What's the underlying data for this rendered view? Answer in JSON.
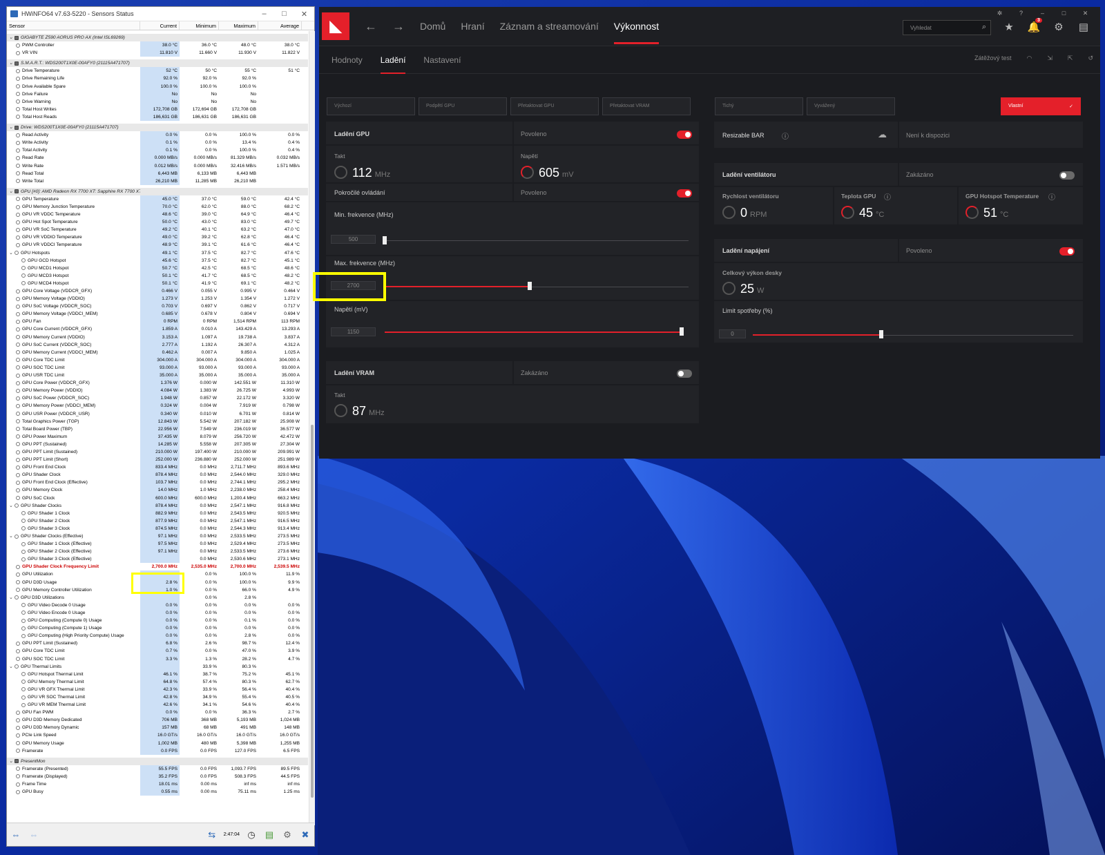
{
  "hwinfo": {
    "title": "HWiNFO64 v7.63-5220 - Sensors Status",
    "columns": [
      "Sensor",
      "Current",
      "Minimum",
      "Maximum",
      "Average"
    ],
    "rows": [
      {
        "g": 1,
        "n": "GIGABYTE Z590 AORUS PRO AX (Intel ISL69269)"
      },
      {
        "n": "PWM Controller",
        "v": [
          "38.0 °C",
          "36.0 °C",
          "48.0 °C",
          "38.0 °C"
        ]
      },
      {
        "n": "VR VIN",
        "v": [
          "11.810 V",
          "11.660 V",
          "11.930 V",
          "11.822 V"
        ]
      },
      {
        "g": 1,
        "n": "S.M.A.R.T.: WDS200T1X0E-00AFY0 (21115A471707)"
      },
      {
        "n": "Drive Temperature",
        "v": [
          "52 °C",
          "50 °C",
          "55 °C",
          "51 °C"
        ]
      },
      {
        "n": "Drive Remaining Life",
        "v": [
          "92.0 %",
          "92.0 %",
          "92.0 %",
          ""
        ]
      },
      {
        "n": "Drive Available Spare",
        "v": [
          "100.0 %",
          "100.0 %",
          "100.0 %",
          ""
        ]
      },
      {
        "n": "Drive Failure",
        "v": [
          "No",
          "No",
          "No",
          ""
        ]
      },
      {
        "n": "Drive Warning",
        "v": [
          "No",
          "No",
          "No",
          ""
        ]
      },
      {
        "n": "Total Host Writes",
        "v": [
          "172,708 GB",
          "172,694 GB",
          "172,708 GB",
          ""
        ]
      },
      {
        "n": "Total Host Reads",
        "v": [
          "186,631 GB",
          "186,631 GB",
          "186,631 GB",
          ""
        ]
      },
      {
        "g": 1,
        "n": "Drive: WDS200T1X0E-00AFY0 (21115A471707)"
      },
      {
        "n": "Read Activity",
        "v": [
          "0.0 %",
          "0.0 %",
          "100.0 %",
          "0.0 %"
        ]
      },
      {
        "n": "Write Activity",
        "v": [
          "0.1 %",
          "0.0 %",
          "13.4 %",
          "0.4 %"
        ]
      },
      {
        "n": "Total Activity",
        "v": [
          "0.1 %",
          "0.0 %",
          "100.0 %",
          "0.4 %"
        ]
      },
      {
        "n": "Read Rate",
        "v": [
          "0.000 MB/s",
          "0.000 MB/s",
          "81.329 MB/s",
          "0.032 MB/s"
        ]
      },
      {
        "n": "Write Rate",
        "v": [
          "0.012 MB/s",
          "0.000 MB/s",
          "32.416 MB/s",
          "1.571 MB/s"
        ]
      },
      {
        "n": "Read Total",
        "v": [
          "6,443 MB",
          "6,133 MB",
          "6,443 MB",
          ""
        ]
      },
      {
        "n": "Write Total",
        "v": [
          "26,210 MB",
          "11,285 MB",
          "26,210 MB",
          ""
        ]
      },
      {
        "g": 1,
        "n": "GPU [#0]: AMD Radeon RX 7700 XT: Sapphire RX 7700 XT Pure"
      },
      {
        "n": "GPU Temperature",
        "v": [
          "45.0 °C",
          "37.0 °C",
          "59.0 °C",
          "42.4 °C"
        ]
      },
      {
        "n": "GPU Memory Junction Temperature",
        "v": [
          "70.0 °C",
          "62.0 °C",
          "88.0 °C",
          "68.2 °C"
        ]
      },
      {
        "n": "GPU VR VDDC Temperature",
        "v": [
          "48.6 °C",
          "39.0 °C",
          "64.9 °C",
          "46.4 °C"
        ]
      },
      {
        "n": "GPU Hot Spot Temperature",
        "v": [
          "50.0 °C",
          "43.0 °C",
          "83.0 °C",
          "49.7 °C"
        ]
      },
      {
        "n": "GPU VR SoC Temperature",
        "v": [
          "49.2 °C",
          "40.1 °C",
          "63.2 °C",
          "47.0 °C"
        ]
      },
      {
        "n": "GPU VR VDDIO Temperature",
        "v": [
          "49.0 °C",
          "39.2 °C",
          "62.8 °C",
          "46.4 °C"
        ]
      },
      {
        "n": "GPU VR VDDCI Temperature",
        "v": [
          "48.9 °C",
          "39.1 °C",
          "61.6 °C",
          "46.4 °C"
        ]
      },
      {
        "n": "GPU Hotspots",
        "e": 1,
        "v": [
          "49.1 °C",
          "37.5 °C",
          "82.7 °C",
          "47.6 °C"
        ]
      },
      {
        "n": "GPU GCD Hotspot",
        "s": 1,
        "v": [
          "45.6 °C",
          "37.5 °C",
          "82.7 °C",
          "45.1 °C"
        ]
      },
      {
        "n": "GPU MCD1 Hotspot",
        "s": 1,
        "v": [
          "50.7 °C",
          "42.5 °C",
          "68.5 °C",
          "48.6 °C"
        ]
      },
      {
        "n": "GPU MCD3 Hotspot",
        "s": 1,
        "v": [
          "50.1 °C",
          "41.7 °C",
          "68.5 °C",
          "48.2 °C"
        ]
      },
      {
        "n": "GPU MCD4 Hotspot",
        "s": 1,
        "v": [
          "50.1 °C",
          "41.9 °C",
          "69.1 °C",
          "48.2 °C"
        ]
      },
      {
        "n": "GPU Core Voltage (VDDCR_GFX)",
        "v": [
          "0.466 V",
          "0.055 V",
          "0.995 V",
          "0.464 V"
        ]
      },
      {
        "n": "GPU Memory Voltage (VDDIO)",
        "v": [
          "1.273 V",
          "1.253 V",
          "1.354 V",
          "1.272 V"
        ]
      },
      {
        "n": "GPU SoC Voltage (VDDCR_SOC)",
        "v": [
          "0.703 V",
          "0.697 V",
          "0.862 V",
          "0.717 V"
        ]
      },
      {
        "n": "GPU Memory Voltage (VDDCI_MEM)",
        "v": [
          "0.685 V",
          "0.678 V",
          "0.804 V",
          "0.694 V"
        ]
      },
      {
        "n": "GPU Fan",
        "v": [
          "0 RPM",
          "0 RPM",
          "1,514 RPM",
          "113 RPM"
        ]
      },
      {
        "n": "GPU Core Current (VDDCR_GFX)",
        "v": [
          "1.859 A",
          "0.010 A",
          "143.429 A",
          "13.293 A"
        ]
      },
      {
        "n": "GPU Memory Current (VDDIO)",
        "v": [
          "3.153 A",
          "1.097 A",
          "19.738 A",
          "3.837 A"
        ]
      },
      {
        "n": "GPU SoC Current (VDDCR_SOC)",
        "v": [
          "2.777 A",
          "1.192 A",
          "26.307 A",
          "4.312 A"
        ]
      },
      {
        "n": "GPU Memory Current (VDDCI_MEM)",
        "v": [
          "0.462 A",
          "0.007 A",
          "9.850 A",
          "1.025 A"
        ]
      },
      {
        "n": "GPU Core TDC Limit",
        "v": [
          "304.000 A",
          "304.000 A",
          "304.000 A",
          "304.000 A"
        ]
      },
      {
        "n": "GPU SOC TDC Limit",
        "v": [
          "93.000 A",
          "93.000 A",
          "93.000 A",
          "93.000 A"
        ]
      },
      {
        "n": "GPU USR TDC Limit",
        "v": [
          "35.000 A",
          "35.000 A",
          "35.000 A",
          "35.000 A"
        ]
      },
      {
        "n": "GPU Core Power (VDDCR_GFX)",
        "v": [
          "1.376 W",
          "0.000 W",
          "142.551 W",
          "11.310 W"
        ]
      },
      {
        "n": "GPU Memory Power (VDDIO)",
        "v": [
          "4.084 W",
          "1.383 W",
          "26.725 W",
          "4.993 W"
        ]
      },
      {
        "n": "GPU SoC Power (VDDCR_SOC)",
        "v": [
          "1.948 W",
          "0.857 W",
          "22.172 W",
          "3.320 W"
        ]
      },
      {
        "n": "GPU Memory Power (VDDCI_MEM)",
        "v": [
          "0.324 W",
          "0.004 W",
          "7.919 W",
          "0.798 W"
        ]
      },
      {
        "n": "GPU USR Power (VDDCR_USR)",
        "v": [
          "0.340 W",
          "0.010 W",
          "6.701 W",
          "0.814 W"
        ]
      },
      {
        "n": "Total Graphics Power (TGP)",
        "v": [
          "12.843 W",
          "5.542 W",
          "207.182 W",
          "25.908 W"
        ]
      },
      {
        "n": "Total Board Power (TBP)",
        "v": [
          "22.956 W",
          "7.549 W",
          "236.019 W",
          "36.577 W"
        ]
      },
      {
        "n": "GPU Power Maximum",
        "v": [
          "37.435 W",
          "8.079 W",
          "256.720 W",
          "42.472 W"
        ]
      },
      {
        "n": "GPU PPT (Sustained)",
        "v": [
          "14.285 W",
          "5.558 W",
          "207.305 W",
          "27.304 W"
        ]
      },
      {
        "n": "GPU PPT Limit (Sustained)",
        "v": [
          "210.000 W",
          "197.400 W",
          "210.000 W",
          "209.991 W"
        ]
      },
      {
        "n": "GPU PPT Limit (Short)",
        "v": [
          "252.000 W",
          "236.880 W",
          "252.000 W",
          "251.989 W"
        ]
      },
      {
        "n": "GPU Front End Clock",
        "v": [
          "833.4 MHz",
          "0.0 MHz",
          "2,711.7 MHz",
          "893.6 MHz"
        ]
      },
      {
        "n": "GPU Shader Clock",
        "v": [
          "878.4 MHz",
          "0.0 MHz",
          "2,544.0 MHz",
          "329.0 MHz"
        ]
      },
      {
        "n": "GPU Front End Clock (Effective)",
        "v": [
          "103.7 MHz",
          "0.0 MHz",
          "2,744.1 MHz",
          "295.2 MHz"
        ]
      },
      {
        "n": "GPU Memory Clock",
        "v": [
          "14.0 MHz",
          "1.0 MHz",
          "2,238.0 MHz",
          "258.4 MHz"
        ]
      },
      {
        "n": "GPU SoC Clock",
        "v": [
          "600.0 MHz",
          "600.0 MHz",
          "1,200.4 MHz",
          "663.2 MHz"
        ]
      },
      {
        "n": "GPU Shader Clocks",
        "e": 1,
        "v": [
          "878.4 MHz",
          "0.0 MHz",
          "2,547.1 MHz",
          "916.8 MHz"
        ]
      },
      {
        "n": "GPU Shader 1 Clock",
        "s": 1,
        "v": [
          "882.9 MHz",
          "0.0 MHz",
          "2,543.5 MHz",
          "920.5 MHz"
        ]
      },
      {
        "n": "GPU Shader 2 Clock",
        "s": 1,
        "v": [
          "877.9 MHz",
          "0.0 MHz",
          "2,547.1 MHz",
          "916.5 MHz"
        ]
      },
      {
        "n": "GPU Shader 3 Clock",
        "s": 1,
        "v": [
          "874.5 MHz",
          "0.0 MHz",
          "2,544.3 MHz",
          "913.4 MHz"
        ]
      },
      {
        "n": "GPU Shader Clocks (Effective)",
        "e": 1,
        "v": [
          "97.1 MHz",
          "0.0 MHz",
          "2,533.5 MHz",
          "273.5 MHz"
        ]
      },
      {
        "n": "GPU Shader 1 Clock (Effective)",
        "s": 1,
        "v": [
          "97.5 MHz",
          "0.0 MHz",
          "2,529.4 MHz",
          "273.5 MHz"
        ]
      },
      {
        "n": "GPU Shader 2 Clock (Effective)",
        "s": 1,
        "v": [
          "97.1 MHz",
          "0.0 MHz",
          "2,533.5 MHz",
          "273.6 MHz"
        ]
      },
      {
        "n": "GPU Shader 3 Clock (Effective)",
        "s": 1,
        "v": [
          "",
          "0.0 MHz",
          "2,530.6 MHz",
          "273.1 MHz"
        ]
      },
      {
        "n": "GPU Shader Clock Frequency Limit",
        "r": 1,
        "v": [
          "2,700.0 MHz",
          "2,535.0 MHz",
          "2,700.0 MHz",
          "2,539.5 MHz"
        ]
      },
      {
        "n": "GPU Utilization",
        "v": [
          "",
          "0.0 %",
          "100.0 %",
          "11.9 %"
        ]
      },
      {
        "n": "GPU D3D Usage",
        "v": [
          "2.8 %",
          "0.0 %",
          "100.0 %",
          "9.9 %"
        ]
      },
      {
        "n": "GPU Memory Controller Utilization",
        "v": [
          "1.0 %",
          "0.0 %",
          "66.0 %",
          "4.9 %"
        ]
      },
      {
        "n": "GPU D3D Utilizations",
        "e": 1,
        "v": [
          "",
          "0.0 %",
          "2.8 %",
          ""
        ]
      },
      {
        "n": "GPU Video Decode 0 Usage",
        "s": 1,
        "v": [
          "0.0 %",
          "0.0 %",
          "0.0 %",
          "0.0 %"
        ]
      },
      {
        "n": "GPU Video Encode 0 Usage",
        "s": 1,
        "v": [
          "0.0 %",
          "0.0 %",
          "0.0 %",
          "0.0 %"
        ]
      },
      {
        "n": "GPU Computing (Compute 0) Usage",
        "s": 1,
        "v": [
          "0.0 %",
          "0.0 %",
          "0.1 %",
          "0.0 %"
        ]
      },
      {
        "n": "GPU Computing (Compute 1) Usage",
        "s": 1,
        "v": [
          "0.0 %",
          "0.0 %",
          "0.0 %",
          "0.0 %"
        ]
      },
      {
        "n": "GPU Computing (High Priority Compute) Usage",
        "s": 1,
        "v": [
          "0.0 %",
          "0.0 %",
          "2.8 %",
          "0.0 %"
        ]
      },
      {
        "n": "GPU PPT Limit (Sustained)",
        "v": [
          "6.8 %",
          "2.6 %",
          "98.7 %",
          "12.4 %"
        ]
      },
      {
        "n": "GPU Core TDC Limit",
        "v": [
          "0.7 %",
          "0.0 %",
          "47.0 %",
          "3.9 %"
        ]
      },
      {
        "n": "GPU SOC TDC Limit",
        "v": [
          "3.3 %",
          "1.3 %",
          "28.2 %",
          "4.7 %"
        ]
      },
      {
        "n": "GPU Thermal Limits",
        "e": 1,
        "v": [
          "",
          "33.9 %",
          "80.3 %",
          ""
        ]
      },
      {
        "n": "GPU Hotspot Thermal Limit",
        "s": 1,
        "v": [
          "46.1 %",
          "38.7 %",
          "75.2 %",
          "45.1 %"
        ]
      },
      {
        "n": "GPU Memory Thermal Limit",
        "s": 1,
        "v": [
          "64.8 %",
          "57.4 %",
          "80.3 %",
          "62.7 %"
        ]
      },
      {
        "n": "GPU VR GFX Thermal Limit",
        "s": 1,
        "v": [
          "42.3 %",
          "33.9 %",
          "56.4 %",
          "40.4 %"
        ]
      },
      {
        "n": "GPU VR SOC Thermal Limit",
        "s": 1,
        "v": [
          "42.8 %",
          "34.9 %",
          "55.4 %",
          "40.5 %"
        ]
      },
      {
        "n": "GPU VR MEM Thermal Limit",
        "s": 1,
        "v": [
          "42.6 %",
          "34.1 %",
          "54.6 %",
          "40.4 %"
        ]
      },
      {
        "n": "GPU Fan PWM",
        "v": [
          "0.0 %",
          "0.0 %",
          "36.3 %",
          "2.7 %"
        ]
      },
      {
        "n": "GPU D3D Memory Dedicated",
        "v": [
          "706 MB",
          "368 MB",
          "5,193 MB",
          "1,024 MB"
        ]
      },
      {
        "n": "GPU D3D Memory Dynamic",
        "v": [
          "157 MB",
          "68 MB",
          "491 MB",
          "148 MB"
        ]
      },
      {
        "n": "PCIe Link Speed",
        "v": [
          "16.0 GT/s",
          "16.0 GT/s",
          "16.0 GT/s",
          "16.0 GT/s"
        ]
      },
      {
        "n": "GPU Memory Usage",
        "v": [
          "1,002 MB",
          "480 MB",
          "5,398 MB",
          "1,255 MB"
        ]
      },
      {
        "n": "Framerate",
        "v": [
          "0.0 FPS",
          "0.0 FPS",
          "127.0 FPS",
          "6.5 FPS"
        ]
      },
      {
        "g": 1,
        "n": "PresentMon"
      },
      {
        "n": "Framerate (Presented)",
        "v": [
          "55.5 FPS",
          "0.0 FPS",
          "1,093.7 FPS",
          "89.5 FPS"
        ]
      },
      {
        "n": "Framerate (Displayed)",
        "v": [
          "35.2 FPS",
          "0.0 FPS",
          "508.3 FPS",
          "44.5 FPS"
        ]
      },
      {
        "n": "Frame Time",
        "v": [
          "18.01 ms",
          "0.00 ms",
          "inf ms",
          "inf ms"
        ]
      },
      {
        "n": "GPU Busy",
        "v": [
          "0.55 ms",
          "0.00 ms",
          "75.11 ms",
          "1.25 ms"
        ]
      }
    ],
    "time": "2:47:04"
  },
  "amd": {
    "nav": [
      "Domů",
      "Hraní",
      "Záznam a streamování",
      "Výkonnost"
    ],
    "search_placeholder": "Vyhledat",
    "notif_count": "3",
    "subtabs": [
      "Hodnoty",
      "Ladění",
      "Nastavení"
    ],
    "stress_test": "Zátěžový test",
    "presets": [
      "Výchozí",
      "Podpětí GPU",
      "Přetaktovat GPU",
      "Přetaktovat VRAM",
      "Tichý",
      "Vyvážený",
      "Vlastní"
    ],
    "gpu": {
      "title": "Ladění GPU",
      "status": "Povoleno",
      "clock_label": "Takt",
      "clock": "112",
      "clock_unit": "MHz",
      "volt_label": "Napětí",
      "volt": "605",
      "volt_unit": "mV",
      "adv_label": "Pokročilé ovládání",
      "adv_status": "Povoleno",
      "min_label": "Min. frekvence (MHz)",
      "min_val": "500",
      "max_label": "Max. frekvence (MHz)",
      "max_val": "2700",
      "vlim_label": "Napětí (mV)",
      "vlim_val": "1150"
    },
    "vram": {
      "title": "Ladění VRAM",
      "status": "Zakázáno",
      "clock_label": "Takt",
      "clock": "87",
      "clock_unit": "MHz"
    },
    "rbar": {
      "title": "Resizable BAR",
      "status": "Není k dispozici"
    },
    "fan": {
      "title": "Ladění ventilátoru",
      "status": "Zakázáno",
      "speed_label": "Rychlost ventilátoru",
      "speed": "0",
      "speed_unit": "RPM",
      "temp_label": "Teplota GPU",
      "temp": "45",
      "temp_unit": "°C",
      "hot_label": "GPU Hotspot Temperature",
      "hot": "51",
      "hot_unit": "°C"
    },
    "power": {
      "title": "Ladění napájení",
      "status": "Povoleno",
      "board_label": "Celkový výkon desky",
      "board": "25",
      "board_unit": "W",
      "limit_label": "Limit spotřeby (%)",
      "limit_val": "0"
    }
  }
}
